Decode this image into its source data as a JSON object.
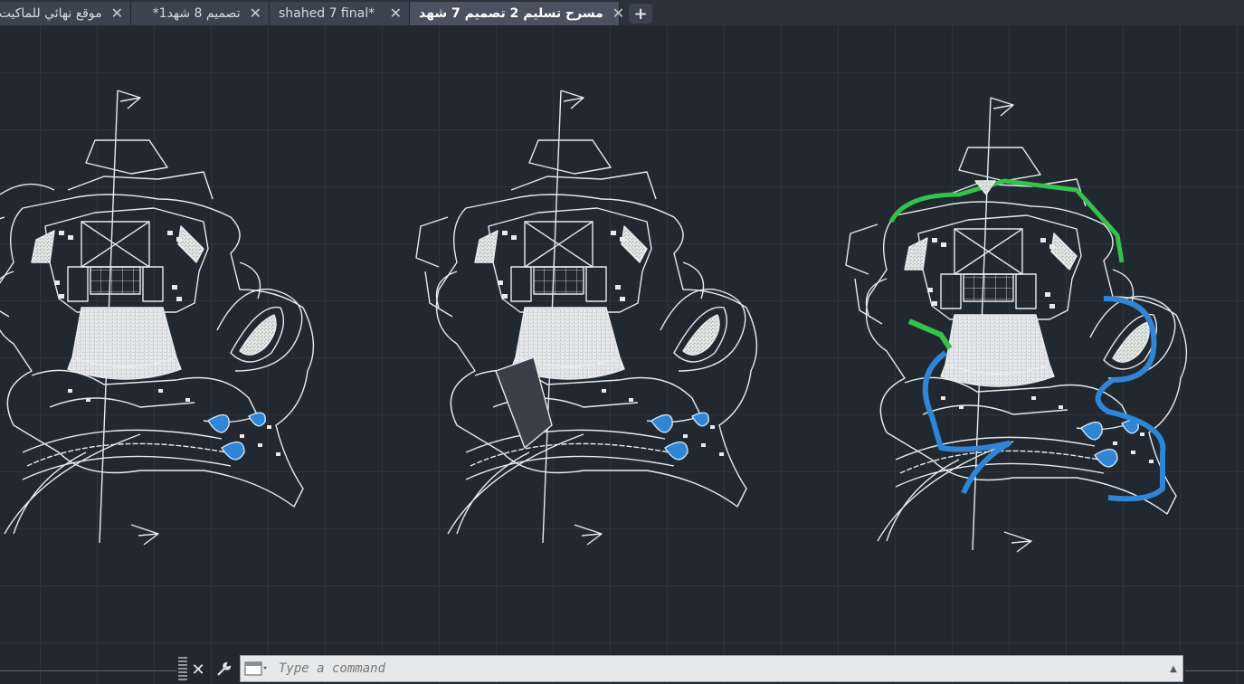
{
  "tabs": [
    {
      "label": "موقع نهائي للماكيت",
      "active": false
    },
    {
      "label": "تصميم 8 شهد1*",
      "active": false
    },
    {
      "label": "shahed 7 final*",
      "active": false
    },
    {
      "label": "مسرح تسليم 2 تصميم 7 شهد",
      "active": true
    }
  ],
  "tab_close_glyph": "✕",
  "add_tab_glyph": "+",
  "commandline": {
    "placeholder": "Type a command",
    "close_glyph": "✕",
    "tools_icon": "wrench-icon"
  },
  "colors": {
    "canvas_bg": "#212830",
    "linework": "#e8eaec",
    "hatch_green": "#33c24a",
    "water_blue": "#2f86d6"
  }
}
